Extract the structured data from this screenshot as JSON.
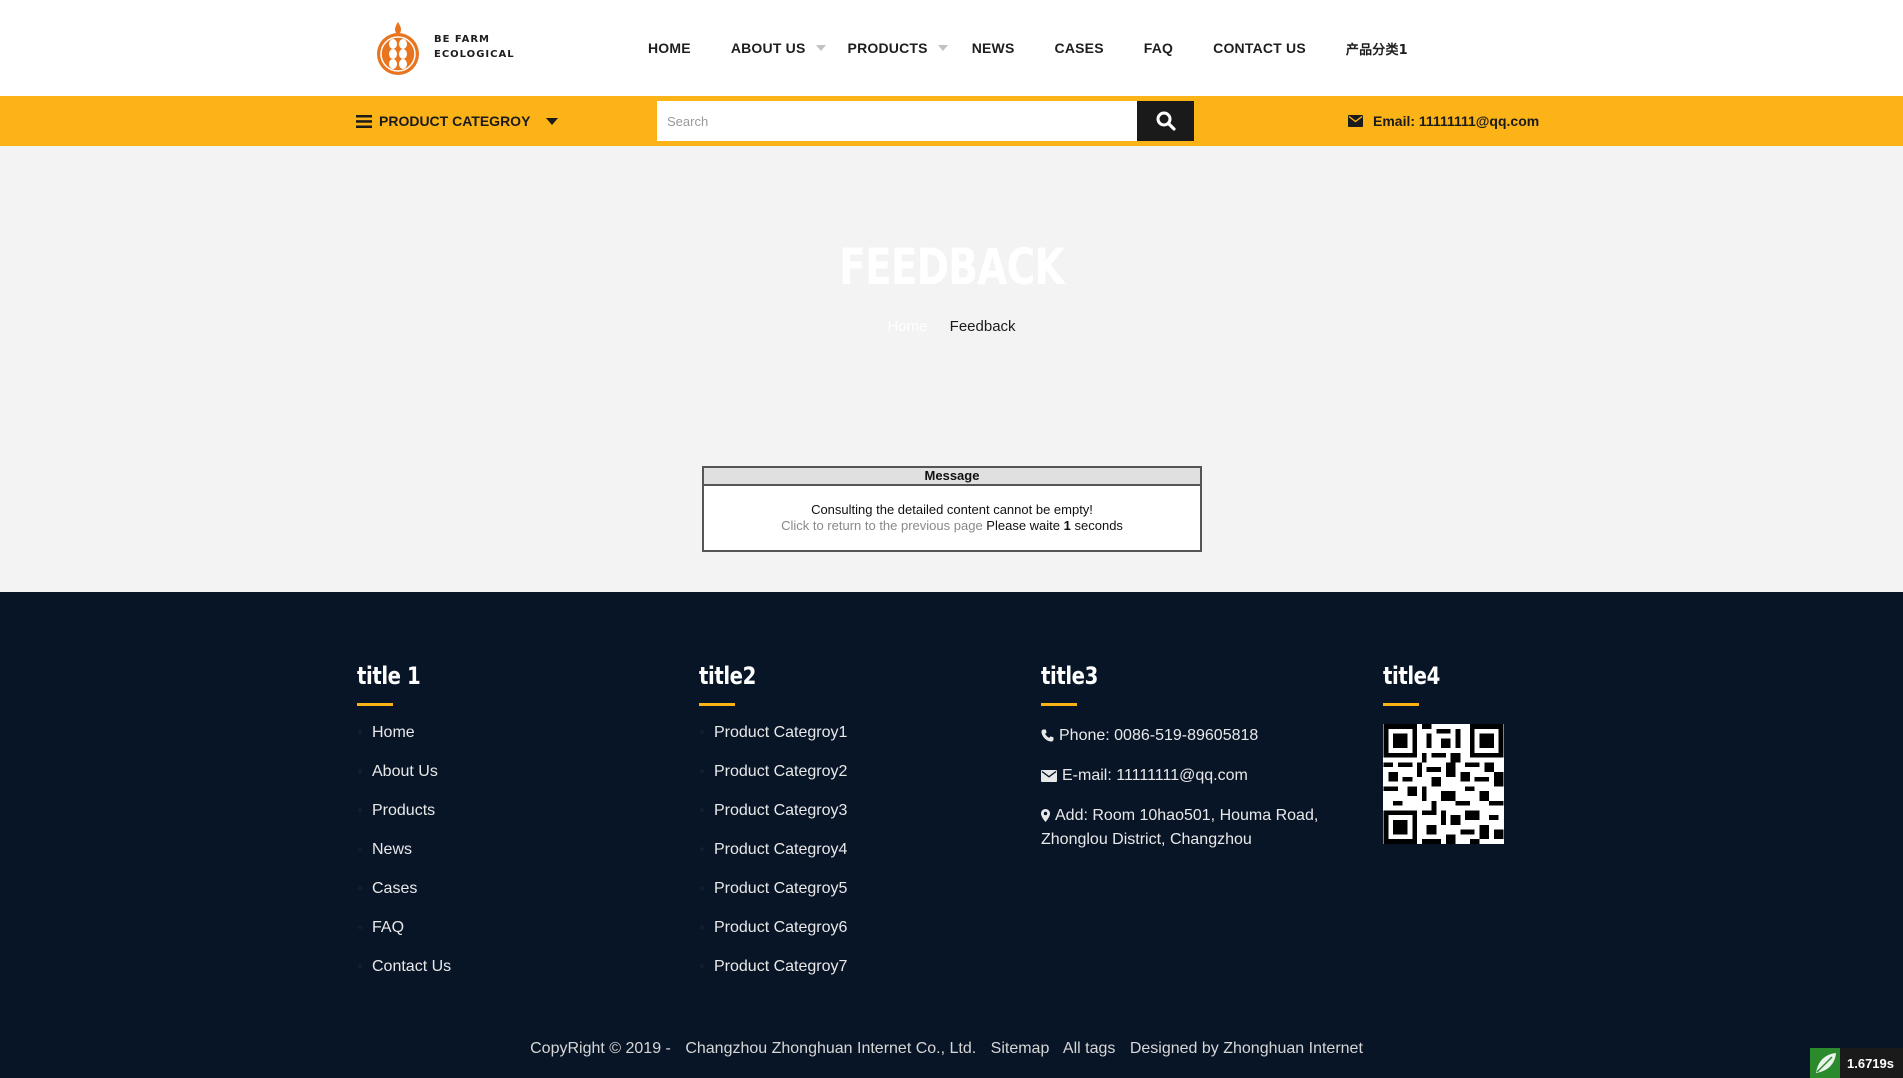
{
  "header": {
    "logo_line1": "BE FARM",
    "logo_line2": "ECOLOGICAL",
    "nav": [
      {
        "label": "HOME"
      },
      {
        "label": "ABOUT US"
      },
      {
        "label": "PRODUCTS"
      },
      {
        "label": "NEWS"
      },
      {
        "label": "CASES"
      },
      {
        "label": "FAQ"
      },
      {
        "label": "CONTACT US"
      },
      {
        "label": "产品分类1"
      }
    ]
  },
  "bar": {
    "category_label": "PRODUCT CATEGROY",
    "search_placeholder": "Search",
    "email_label": "Email: 11111111@qq.com"
  },
  "banner": {
    "title": "FEEDBACK",
    "crumb_home": "Home",
    "crumb_current": "Feedback"
  },
  "message": {
    "head": "Message",
    "line1": "Consulting the detailed content cannot be empty!",
    "back_link": "Click to return to the previous page",
    "wait_prefix": "Please waite",
    "wait_seconds": "1",
    "wait_suffix": "seconds"
  },
  "footer": {
    "col1": {
      "title": "title 1",
      "links": [
        "Home",
        "About Us",
        "Products",
        "News",
        "Cases",
        "FAQ",
        "Contact Us"
      ]
    },
    "col2": {
      "title": "title2",
      "links": [
        "Product Categroy1",
        "Product Categroy2",
        "Product Categroy3",
        "Product Categroy4",
        "Product Categroy5",
        "Product Categroy6",
        "Product Categroy7"
      ]
    },
    "col3": {
      "title": "title3",
      "phone": "Phone: 0086-519-89605818",
      "email": "E-mail: 11111111@qq.com",
      "address_line1": "Add: Room 10hao501, Houma Road,",
      "address_line2": "Zhonglou District, Changzhou"
    },
    "col4": {
      "title": "title4"
    },
    "copyright": "CopyRight © 2019 -",
    "company": "Changzhou Zhonghuan Internet Co., Ltd.",
    "sitemap": "Sitemap",
    "all_tags": "All tags",
    "designed_by": "Designed by Zhonghuan Internet"
  },
  "timer": "1.6719s",
  "colors": {
    "accent": "#fcb317",
    "footer_bg": "#081527",
    "logo_orange": "#e8741e"
  }
}
